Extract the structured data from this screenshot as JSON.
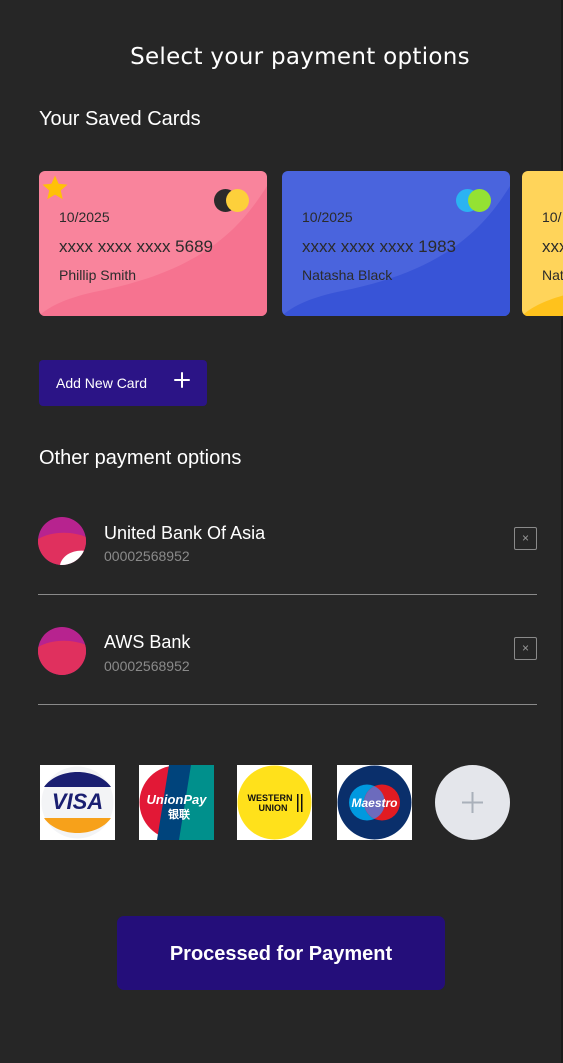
{
  "header": {
    "title": "Select your payment options"
  },
  "saved_cards": {
    "title": "Your Saved Cards",
    "cards": [
      {
        "expiry": "10/2025",
        "number": "xxxx xxxx xxxx 5689",
        "holder": "Phillip Smith",
        "favorite": true,
        "color": "#f9849c"
      },
      {
        "expiry": "10/2025",
        "number": "xxxx xxxx xxxx 1983",
        "holder": "Natasha Black",
        "favorite": false,
        "color": "#4a64dd"
      },
      {
        "expiry": "10/",
        "number": "xxx",
        "holder": "Nat",
        "favorite": false,
        "color": "#ffc93c"
      }
    ],
    "add_button_label": "Add New Card"
  },
  "other_options": {
    "title": "Other payment options",
    "banks": [
      {
        "name": "United Bank Of Asia",
        "account": "00002568952"
      },
      {
        "name": "AWS Bank",
        "account": "00002568952"
      }
    ],
    "remove_icon": "×"
  },
  "payment_methods": {
    "logos": [
      {
        "name": "VISA",
        "icon": "visa-icon"
      },
      {
        "name": "UnionPay",
        "icon": "unionpay-icon"
      },
      {
        "name": "WESTERN UNION",
        "icon": "western-union-icon"
      },
      {
        "name": "Maestro",
        "icon": "maestro-icon"
      }
    ],
    "add_icon": "plus-icon"
  },
  "footer": {
    "pay_button_label": "Processed for Payment"
  },
  "colors": {
    "background": "#262626",
    "primary": "#2b1486",
    "pay_button": "#240e7a"
  }
}
